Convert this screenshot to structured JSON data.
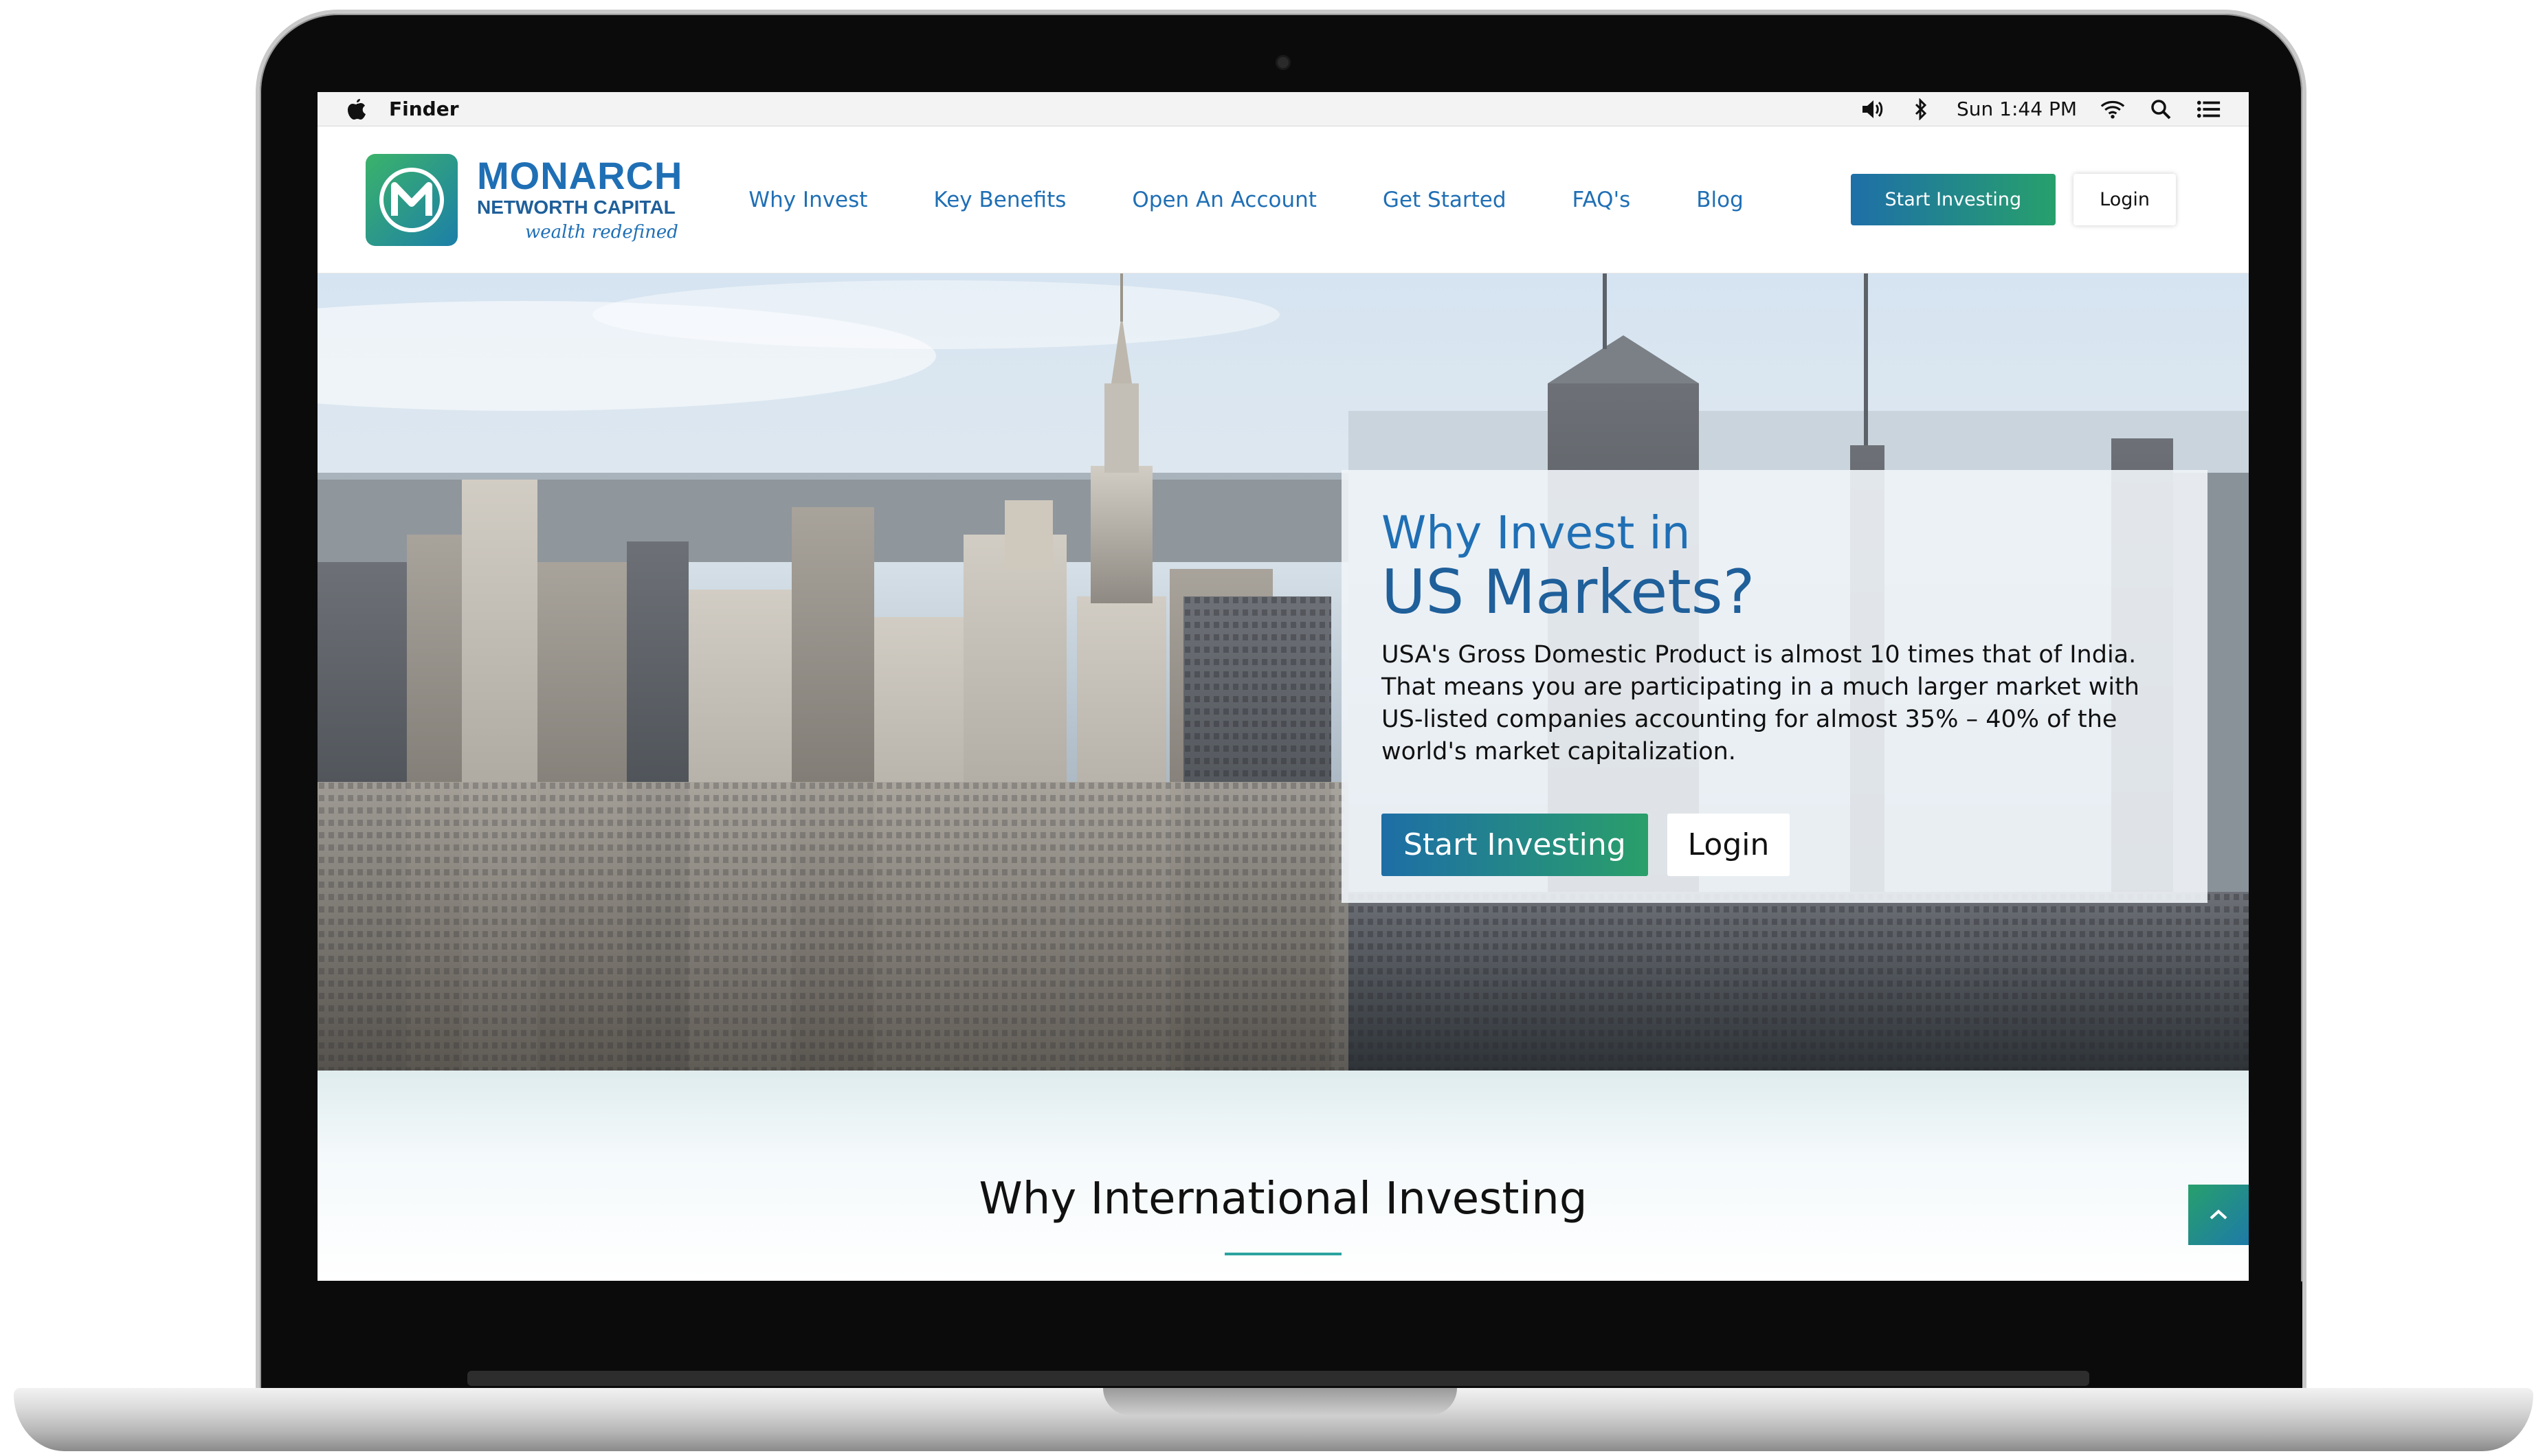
{
  "menubar": {
    "app_name": "Finder",
    "clock": "Sun 1:44 PM"
  },
  "site": {
    "logo": {
      "name": "MONARCH",
      "subname": "NETWORTH CAPITAL",
      "tagline": "wealth redefined"
    },
    "nav": [
      {
        "label": "Why Invest"
      },
      {
        "label": "Key Benefits"
      },
      {
        "label": "Open An Account"
      },
      {
        "label": "Get Started"
      },
      {
        "label": "FAQ's"
      },
      {
        "label": "Blog"
      }
    ],
    "header_actions": {
      "start_label": "Start Investing",
      "login_label": "Login"
    }
  },
  "hero": {
    "title_line1": "Why Invest in",
    "title_line2": "US Markets?",
    "body": "USA's Gross Domestic Product is almost 10 times that of India. That means you are participating in a much larger market with US-listed companies accounting for almost 35% – 40% of the world's market capitalization.",
    "start_label": "Start Investing",
    "login_label": "Login"
  },
  "section": {
    "title": "Why International Investing"
  },
  "colors": {
    "brand_blue": "#1f6fb5",
    "brand_green": "#27a06c"
  },
  "icons": [
    "apple-icon",
    "volume-icon",
    "bluetooth-icon",
    "wifi-icon",
    "spotlight-search-icon",
    "notification-center-icon",
    "chevron-up-icon"
  ]
}
